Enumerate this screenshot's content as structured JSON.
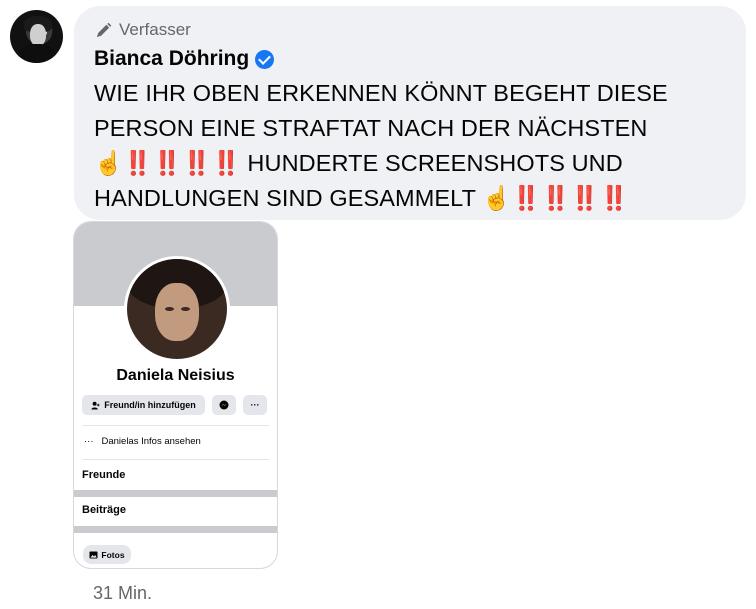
{
  "comment": {
    "role_label": "Verfasser",
    "author_name": "Bianca Döhring",
    "message": "WIE IHR OBEN ERKENNEN KÖNNT BEGEHT DIESE PERSON EINE STRAFTAT NACH DER NÄCHSTEN ☝️‼️‼️‼️‼️ HUNDERTE SCREENSHOTS UND HANDLUNGEN SIND GESAMMELT ☝️‼️‼️‼️‼️",
    "timestamp": "31 Min.",
    "verified_color": "#1877f2"
  },
  "screenshot": {
    "profile_name": "Daniela Neisius",
    "add_friend_label": "Freund/in hinzufügen",
    "more_label": "···",
    "info_label": "Danielas Infos ansehen",
    "info_dots": "···",
    "friends_label": "Freunde",
    "posts_label": "Beiträge",
    "photos_label": "Fotos"
  },
  "icons": {
    "role": "pencil-icon",
    "verified": "verified-badge-icon",
    "add_friend": "add-person-icon",
    "messenger": "messenger-icon",
    "photos": "photo-icon"
  }
}
